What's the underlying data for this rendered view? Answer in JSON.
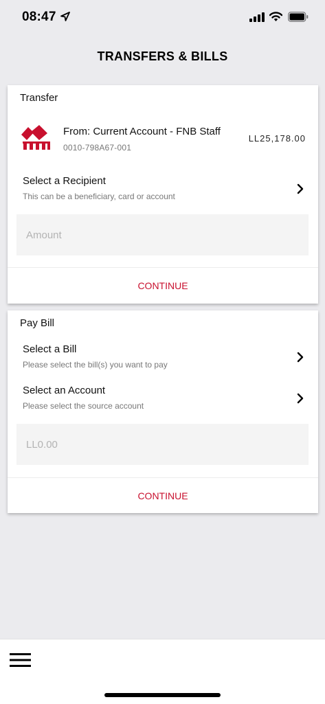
{
  "status_bar": {
    "time": "08:47"
  },
  "page": {
    "title": "TRANSFERS & BILLS"
  },
  "transfer": {
    "heading": "Transfer",
    "from_label": "From: Current Account - FNB Staff",
    "account_number": "0010-798A67-001",
    "balance": "LL25,178.00",
    "recipient_title": "Select a Recipient",
    "recipient_subtitle": "This can be a beneficiary, card or account",
    "amount_placeholder": "Amount",
    "continue_label": "CONTINUE"
  },
  "pay_bill": {
    "heading": "Pay Bill",
    "bill_title": "Select a Bill",
    "bill_subtitle": "Please select the bill(s) you want to pay",
    "account_title": "Select an Account",
    "account_subtitle": "Please select the source account",
    "amount_placeholder": "LL0.00",
    "continue_label": "CONTINUE"
  },
  "colors": {
    "accent": "#c8102e",
    "background": "#ebebee"
  },
  "icons": {
    "location": "location-arrow-icon",
    "signal": "cellular-signal-icon",
    "wifi": "wifi-icon",
    "battery": "battery-icon",
    "chevron": "chevron-right-icon",
    "menu": "hamburger-menu-icon",
    "logo": "fnb-logo-icon"
  }
}
